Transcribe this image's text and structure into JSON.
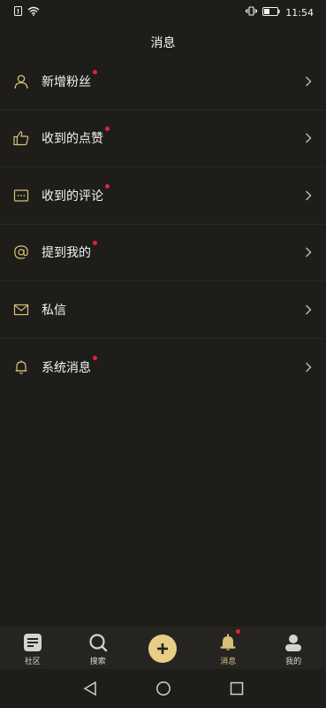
{
  "status_bar": {
    "time": "11:54",
    "icons": [
      "sim-icon",
      "wifi-icon",
      "vibrate-icon",
      "battery-icon"
    ]
  },
  "page": {
    "title": "消息"
  },
  "menu": {
    "items": [
      {
        "label": "新增粉丝",
        "icon": "person-icon",
        "has_dot": true
      },
      {
        "label": "收到的点赞",
        "icon": "thumbs-up-icon",
        "has_dot": true
      },
      {
        "label": "收到的评论",
        "icon": "comment-icon",
        "has_dot": true
      },
      {
        "label": "提到我的",
        "icon": "at-icon",
        "has_dot": true
      },
      {
        "label": "私信",
        "icon": "mail-icon",
        "has_dot": false
      },
      {
        "label": "系统消息",
        "icon": "bell-icon",
        "has_dot": true
      }
    ]
  },
  "tabbar": {
    "tabs": [
      {
        "label": "社区",
        "icon": "community-icon",
        "active": false
      },
      {
        "label": "搜索",
        "icon": "search-icon",
        "active": false
      },
      {
        "label": "",
        "icon": "plus-icon",
        "active": false
      },
      {
        "label": "消息",
        "icon": "bell-icon",
        "active": true,
        "has_dot": true
      },
      {
        "label": "我的",
        "icon": "profile-icon",
        "active": false
      }
    ]
  },
  "colors": {
    "background": "#1f1d1a",
    "accent": "#e7cd86",
    "icon_gold": "#d8c07a",
    "notification_dot": "#e0233a"
  }
}
